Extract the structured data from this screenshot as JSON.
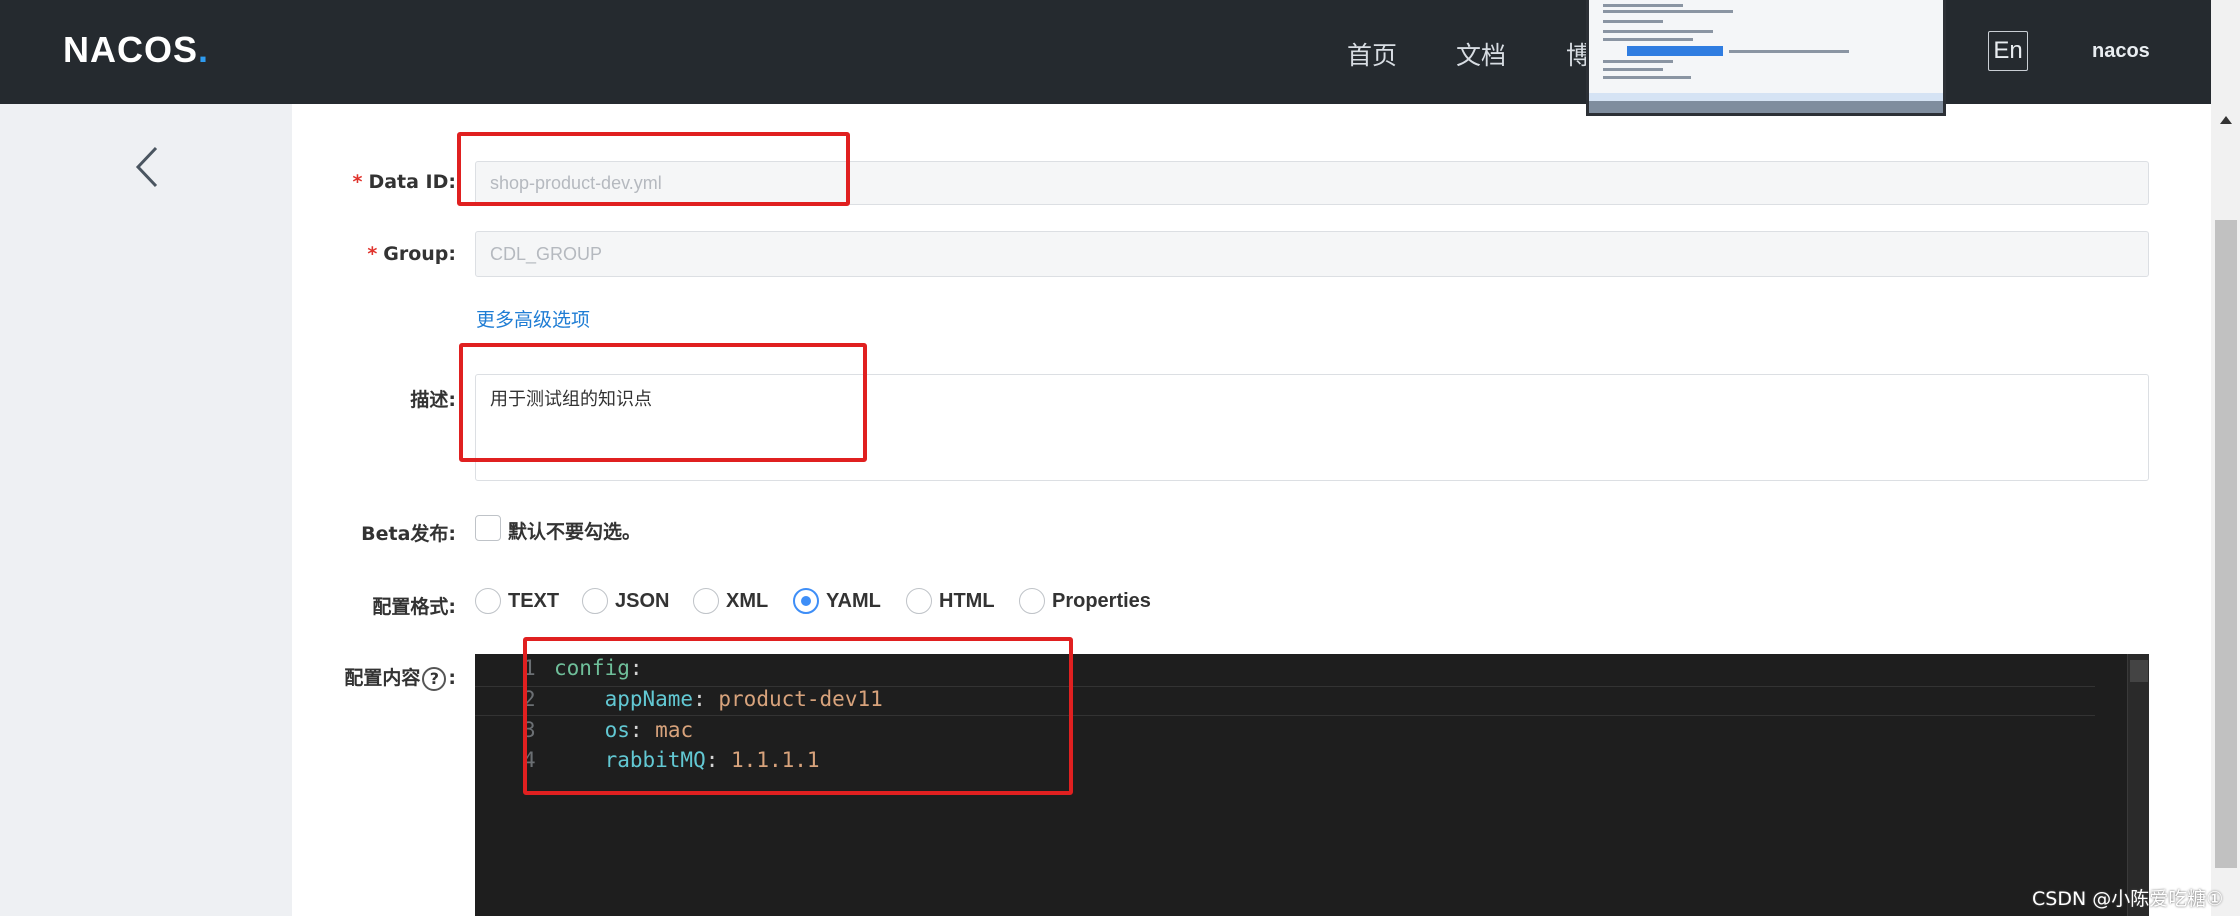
{
  "header": {
    "logo": "NACOS",
    "logo_dot": ".",
    "nav": [
      "首页",
      "文档",
      "博"
    ],
    "lang": "En",
    "user": "nacos"
  },
  "form": {
    "data_id_label": "Data ID:",
    "data_id_value": "shop-product-dev.yml",
    "group_label": "Group:",
    "group_value": "CDL_GROUP",
    "advanced_link": "更多高级选项",
    "desc_label": "描述:",
    "desc_value": "用于测试组的知识点",
    "beta_label": "Beta发布:",
    "beta_checkbox_label": "默认不要勾选。",
    "format_label": "配置格式:",
    "formats": [
      "TEXT",
      "JSON",
      "XML",
      "YAML",
      "HTML",
      "Properties"
    ],
    "selected_format": "YAML",
    "content_label_pre": "配置内容",
    "content_label_help": "?",
    "content_label_post": ":"
  },
  "editor": {
    "line_numbers": [
      "1",
      "2",
      "3",
      "4"
    ],
    "lines": [
      {
        "indent": "",
        "key": "config",
        "sep": ":",
        "value": ""
      },
      {
        "indent": "    ",
        "key": "appName",
        "sep": ": ",
        "value": "product-dev11"
      },
      {
        "indent": "    ",
        "key": "os",
        "sep": ": ",
        "value": "mac"
      },
      {
        "indent": "    ",
        "key": "rabbitMQ",
        "sep": ": ",
        "value": "1.1.1.1"
      }
    ]
  },
  "watermark": "CSDN @小陈爱吃糖①",
  "colors": {
    "header_bg": "#252a2f",
    "sidebar_bg": "#eef0f3",
    "editor_bg": "#1e1e1e",
    "annotation_red": "#e02020",
    "link_blue": "#1f7dd4",
    "radio_selected": "#3e8ef7"
  }
}
